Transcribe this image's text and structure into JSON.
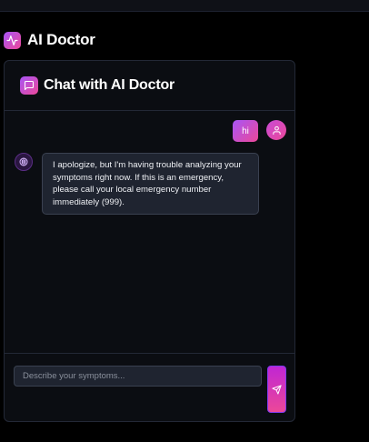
{
  "app": {
    "title": "AI Doctor",
    "logo_icon": "activity-icon"
  },
  "chat": {
    "title": "Chat with AI Doctor",
    "header_icon": "message-square-icon",
    "messages": [
      {
        "role": "user",
        "text": "hi",
        "avatar_icon": "user-icon"
      },
      {
        "role": "assistant",
        "text": "I apologize, but I'm having trouble analyzing your symptoms right now. If this is an emergency, please call your local emergency number immediately (999).",
        "avatar_icon": "brain-icon"
      }
    ]
  },
  "composer": {
    "placeholder": "Describe your symptoms...",
    "value": "",
    "send_icon": "send-icon"
  },
  "colors": {
    "accent_start": "#a855f7",
    "accent_end": "#ec4899",
    "background": "#000000",
    "card_background": "#0b0d12",
    "bubble_background": "#1f2430"
  }
}
